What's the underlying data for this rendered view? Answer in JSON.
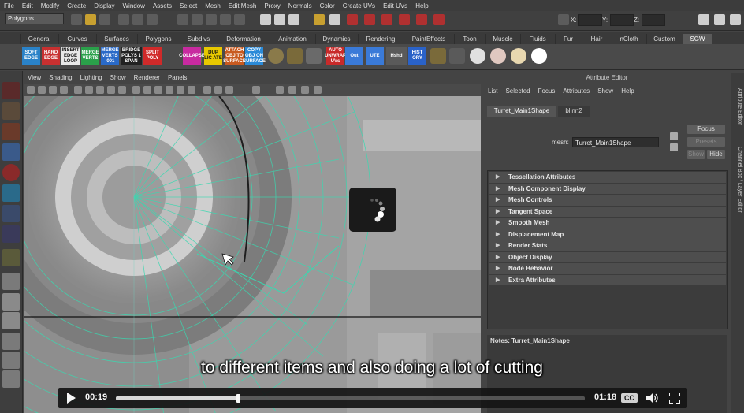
{
  "menubar": {
    "items": [
      "File",
      "Edit",
      "Modify",
      "Create",
      "Display",
      "Window",
      "Assets",
      "Select",
      "Mesh",
      "Edit Mesh",
      "Proxy",
      "Normals",
      "Color",
      "Create UVs",
      "Edit UVs",
      "Help"
    ]
  },
  "statusline": {
    "mode": "Polygons",
    "x_label": "X:",
    "y_label": "Y:",
    "z_label": "Z:"
  },
  "shelf_tabs": {
    "items": [
      "General",
      "Curves",
      "Surfaces",
      "Polygons",
      "Subdivs",
      "Deformation",
      "Animation",
      "Dynamics",
      "Rendering",
      "PaintEffects",
      "Toon",
      "Muscle",
      "Fluids",
      "Fur",
      "Hair",
      "nCloth",
      "Custom",
      "SGW"
    ],
    "active": "SGW"
  },
  "shelf_buttons": [
    {
      "label": "SOFT EDGE",
      "color": "#2a82c8"
    },
    {
      "label": "HARD EDGE",
      "color": "#c83030"
    },
    {
      "label": "INSERT EDGE LOOP",
      "color": "#e8e8e8"
    },
    {
      "label": "MERGE VERTS",
      "color": "#2aa04a"
    },
    {
      "label": "MERGE VERTS .001",
      "color": "#2a6ac8"
    },
    {
      "label": "BRIDGE POLYS 1 SPAN",
      "color": "#222222"
    },
    {
      "label": "SPLIT POLY",
      "color": "#d02a2a"
    },
    {
      "label": "COLLAPSE",
      "color": "#c82aa0"
    },
    {
      "label": "DUP LIC ATE",
      "color": "#e8c800"
    },
    {
      "label": "ATTACH OBJ TO SURFACE",
      "color": "#c85a20"
    },
    {
      "label": "COPY OBJ ON SURFACE",
      "color": "#2a8ad8"
    },
    {
      "label": "AUTO UNWRAP UVs",
      "color": "#c82a2a"
    },
    {
      "label": "Out",
      "color": "#3a7ad8"
    },
    {
      "label": "UTE",
      "color": "#3a7ad8"
    },
    {
      "label": "Hshd",
      "color": "#5a5a5a"
    },
    {
      "label": "HIST ORY",
      "color": "#2a62c8"
    }
  ],
  "viewport": {
    "menu": [
      "View",
      "Shading",
      "Lighting",
      "Show",
      "Renderer",
      "Panels"
    ]
  },
  "attribute_editor": {
    "title": "Attribute Editor",
    "menu": [
      "List",
      "Selected",
      "Focus",
      "Attributes",
      "Show",
      "Help"
    ],
    "tabs": [
      "Turret_Main1Shape",
      "blinn2"
    ],
    "active_tab": "Turret_Main1Shape",
    "mesh_label": "mesh:",
    "mesh_value": "Turret_Main1Shape",
    "focus_button": "Focus",
    "presets_button": "Presets",
    "show_button": "Show",
    "hide_button": "Hide",
    "sections": [
      "Tessellation Attributes",
      "Mesh Component Display",
      "Mesh Controls",
      "Tangent Space",
      "Smooth Mesh",
      "Displacement Map",
      "Render Stats",
      "Object Display",
      "Node Behavior",
      "Extra Attributes"
    ],
    "notes_label": "Notes:  Turret_Main1Shape"
  },
  "side_tabs": [
    "Attribute Editor",
    "Channel Box / Layer Editor"
  ],
  "video": {
    "caption": "to different items and also doing a lot of cutting",
    "current_time": "00:19",
    "duration": "01:18",
    "progress_fraction": 0.26,
    "cc_label": "CC"
  },
  "colors": {
    "wireframe": "#3ad8b0",
    "selected_edge": "#1e1e1e",
    "panel_bg": "#444444"
  }
}
